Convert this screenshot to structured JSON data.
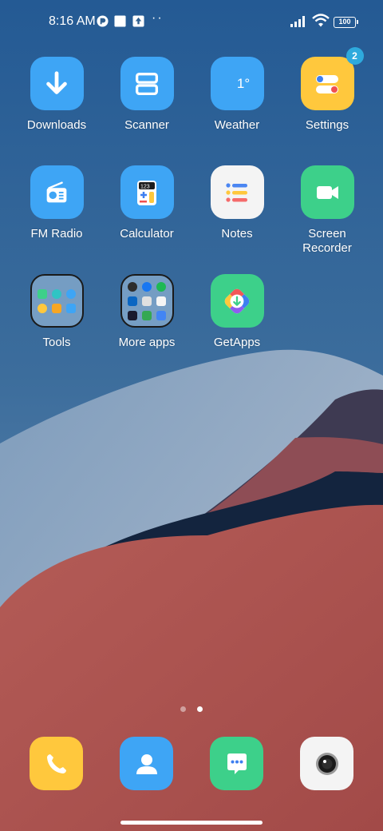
{
  "status_bar": {
    "time": "8:16 AM",
    "battery": "100",
    "icons": [
      "notification-app-icon",
      "notification-square-icon",
      "notification-upload-icon",
      "more-dots-icon",
      "signal-icon",
      "wifi-icon",
      "battery-icon"
    ]
  },
  "apps": {
    "downloads": {
      "label": "Downloads",
      "icon": "download-arrow-icon",
      "color": "#3ea5f5"
    },
    "scanner": {
      "label": "Scanner",
      "icon": "scanner-icon",
      "color": "#3ea5f5"
    },
    "weather": {
      "label": "Weather",
      "temp": "1°",
      "icon": "weather-icon",
      "color": "#3ea5f5"
    },
    "settings": {
      "label": "Settings",
      "badge": "2",
      "icon": "toggle-icon",
      "color": "#ffc83d"
    },
    "fm_radio": {
      "label": "FM Radio",
      "icon": "radio-icon",
      "color": "#3ea5f5"
    },
    "calculator": {
      "label": "Calculator",
      "display": "123",
      "icon": "calculator-icon",
      "color": "#3ea5f5"
    },
    "notes": {
      "label": "Notes",
      "icon": "notes-list-icon",
      "color": "#f4f4f4"
    },
    "screen_recorder": {
      "label": "Screen\nRecorder",
      "icon": "video-camera-icon",
      "color": "#3dd08a"
    },
    "tools": {
      "label": "Tools",
      "icon": "folder-icon"
    },
    "more_apps": {
      "label": "More apps",
      "icon": "folder-icon"
    },
    "getapps": {
      "label": "GetApps",
      "icon": "getapps-icon",
      "color": "#3dd08a"
    }
  },
  "page_indicator": {
    "pages": 2,
    "current": 2
  },
  "dock": [
    {
      "name": "phone",
      "icon": "phone-icon",
      "color": "#ffc83d"
    },
    {
      "name": "contacts",
      "icon": "contact-person-icon",
      "color": "#3ea5f5"
    },
    {
      "name": "messages",
      "icon": "message-bubble-icon",
      "color": "#3dd08a"
    },
    {
      "name": "camera",
      "icon": "camera-lens-icon",
      "color": "#f4f4f4"
    }
  ]
}
